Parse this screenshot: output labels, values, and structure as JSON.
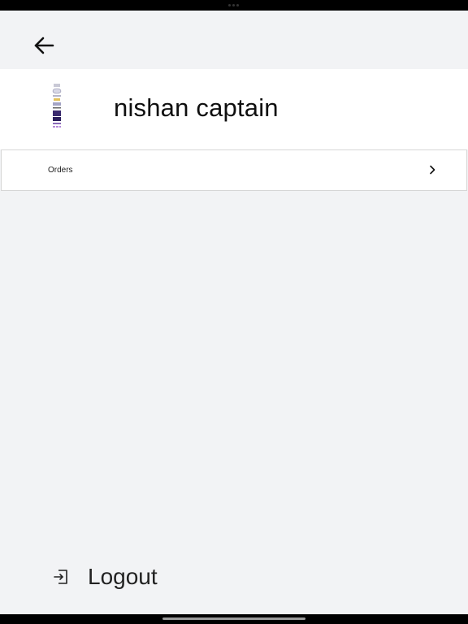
{
  "icons": {
    "back": "back-arrow-icon",
    "orders_chevron": "chevron-right-icon",
    "logout": "logout-icon",
    "avatar": "product-image-avatar"
  },
  "profile": {
    "name": "nishan captain"
  },
  "menu": {
    "items": [
      {
        "label": "Orders"
      }
    ]
  },
  "footer": {
    "logout_label": "Logout"
  }
}
